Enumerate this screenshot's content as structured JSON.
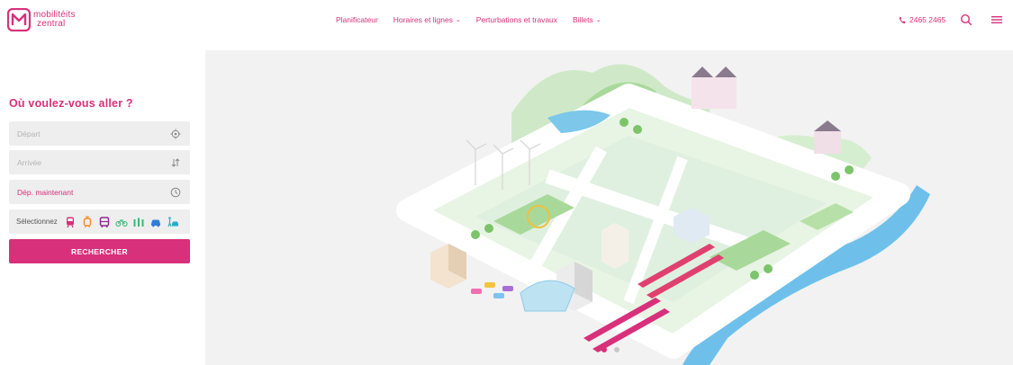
{
  "header": {
    "logo": {
      "line1": "mobilitéits",
      "line2": "zentral"
    },
    "nav": [
      {
        "label": "Planificateur",
        "dropdown": false
      },
      {
        "label": "Horaires et lignes",
        "dropdown": true
      },
      {
        "label": "Perturbations et travaux",
        "dropdown": false
      },
      {
        "label": "Billets",
        "dropdown": true
      }
    ],
    "phone": "2465 2465",
    "accent_color": "#d8307a"
  },
  "planner": {
    "title": "Où voulez-vous aller ?",
    "departure_placeholder": "Départ",
    "arrival_placeholder": "Arrivée",
    "time_value": "Dép. maintenant",
    "modes_label": "Sélectionnez",
    "modes": [
      "train",
      "tram",
      "bus",
      "bike",
      "shared-bike",
      "car",
      "pedestrian"
    ],
    "search_label": "RECHERCHER"
  },
  "hero": {
    "illustration": "isometric-city-transport",
    "carousel": {
      "slides": 2,
      "active": 1
    }
  }
}
